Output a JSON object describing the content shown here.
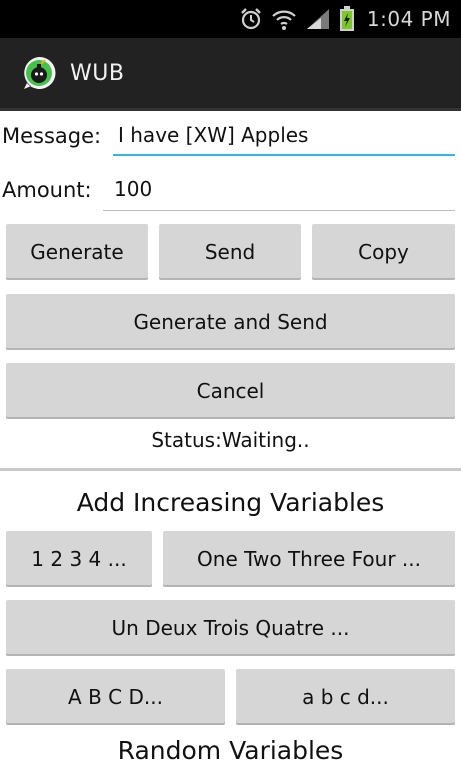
{
  "status_bar": {
    "time": "1:04 PM"
  },
  "app": {
    "title": "WUB"
  },
  "form": {
    "message_label": "Message:",
    "message_value": "I have [XW] Apples",
    "amount_label": "Amount:",
    "amount_value": "100"
  },
  "buttons": {
    "generate": "Generate",
    "send": "Send",
    "copy": "Copy",
    "generate_and_send": "Generate and Send",
    "cancel": "Cancel"
  },
  "status": {
    "text": "Status:Waiting.."
  },
  "increasing": {
    "title": "Add Increasing Variables",
    "numbers": "1 2 3 4 ...",
    "words_en": "One Two Three Four ...",
    "words_fr": "Un Deux Trois Quatre ...",
    "upper_letters": "A B C D...",
    "lower_letters": "a b c d..."
  },
  "random": {
    "title": "Random Variables"
  },
  "colors": {
    "accent": "#33b5e5",
    "action_bar": "#222222",
    "button": "#d6d6d6"
  }
}
